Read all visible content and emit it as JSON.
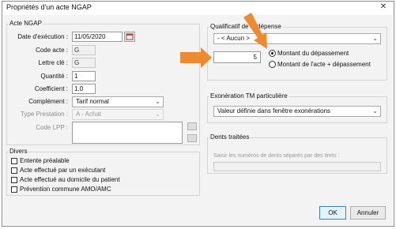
{
  "window": {
    "title": "Propriétés d'un acte NGAP",
    "close_glyph": "✕"
  },
  "acte_ngap": {
    "title": "Acte NGAP",
    "date_label": "Date d'exécution :",
    "date_value": "11/05/2020",
    "code_label": "Code acte :",
    "code_value": "G",
    "lettre_label": "Lettre clé :",
    "lettre_value": "G",
    "quantite_label": "Quantité :",
    "quantite_value": "1",
    "coefficient_label": "Coefficient :",
    "coefficient_value": "1.0",
    "complement_label": "Complément :",
    "complement_value": "Tarif normal",
    "type_prestation_label": "Type Prestation :",
    "type_prestation_value": "A - Achat",
    "code_lpp_label": "Code LPP :",
    "code_lpp_value": ""
  },
  "divers": {
    "title": "Divers",
    "items": [
      {
        "label": "Entente préalable",
        "checked": false
      },
      {
        "label": "Acte effectué par un exécutant",
        "checked": false
      },
      {
        "label": "Acte effectué au domicile du patient",
        "checked": false
      },
      {
        "label": "Prévention commune AMO/AMC",
        "checked": false
      }
    ]
  },
  "qualificatif": {
    "title": "Qualificatif de la dépense",
    "select_value": "- < Aucun >",
    "amount_value": "5",
    "radio_1": "Montant du dépassement",
    "radio_2": "Montant de l'acte + dépassement",
    "selected_radio": 1
  },
  "exoneration": {
    "title": "Exonération TM particulière",
    "select_value": "Valeur définie dans fenêtre exonérations"
  },
  "dents": {
    "title": "Dents traitées",
    "hint": "Saisir les numéros de dents séparés par des tirets :",
    "value": ""
  },
  "buttons": {
    "ok": "OK",
    "cancel": "Annuler"
  },
  "colors": {
    "annotation_arrow": "#ee8a32",
    "default_button_border": "#3c7fb1"
  },
  "icons": {
    "calendar": "calendar-icon",
    "combo": "chevron-down-icon"
  }
}
